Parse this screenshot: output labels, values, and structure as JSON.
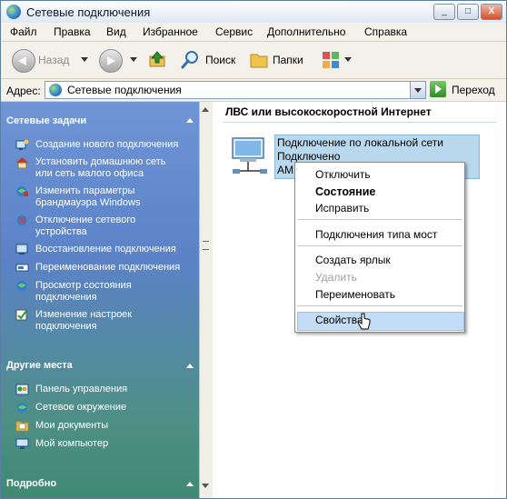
{
  "window": {
    "title": "Сетевые подключения",
    "min_btn": "_",
    "max_btn": "□",
    "close_btn": "X"
  },
  "menubar": [
    "Файл",
    "Правка",
    "Вид",
    "Избранное",
    "Сервис",
    "Дополнительно",
    "Справка"
  ],
  "toolbar": {
    "back_label": "Назад",
    "search_label": "Поиск",
    "folders_label": "Папки"
  },
  "address": {
    "label": "Адрес:",
    "value": "Сетевые подключения",
    "go_label": "Переход"
  },
  "network_tasks": {
    "header": "Сетевые задачи",
    "items": [
      {
        "label": "Создание нового подключения",
        "icon": "new-connection-icon"
      },
      {
        "label": "Установить домашнюю сеть или сеть малого офиса",
        "icon": "home-network-icon"
      },
      {
        "label": "Изменить параметры брандмауэра Windows",
        "icon": "firewall-icon"
      },
      {
        "label": "Отключение сетевого устройства",
        "icon": "disable-device-icon"
      },
      {
        "label": "Восстановление подключения",
        "icon": "repair-icon"
      },
      {
        "label": "Переименование подключения",
        "icon": "rename-icon"
      },
      {
        "label": "Просмотр состояния подключения",
        "icon": "status-icon"
      },
      {
        "label": "Изменение настроек подключения",
        "icon": "settings-icon"
      }
    ]
  },
  "other_places": {
    "header": "Другие места",
    "items": [
      {
        "label": "Панель управления",
        "icon": "control-panel-icon"
      },
      {
        "label": "Сетевое окружение",
        "icon": "network-places-icon"
      },
      {
        "label": "Мои документы",
        "icon": "my-documents-icon"
      },
      {
        "label": "Мой компьютер",
        "icon": "my-computer-icon"
      }
    ]
  },
  "details": {
    "header": "Подробно"
  },
  "content": {
    "group_heading": "ЛВС или высокоскоростной Интернет",
    "connection": {
      "name": "Подключение по локальной сети",
      "status": "Подключено",
      "adapter": "AMD"
    }
  },
  "context_menu": {
    "disable": "Отключить",
    "status": "Состояние",
    "repair": "Исправить",
    "bridge": "Подключения типа мост",
    "shortcut": "Создать ярлык",
    "delete": "Удалить",
    "rename": "Переименовать",
    "properties": "Свойства"
  }
}
